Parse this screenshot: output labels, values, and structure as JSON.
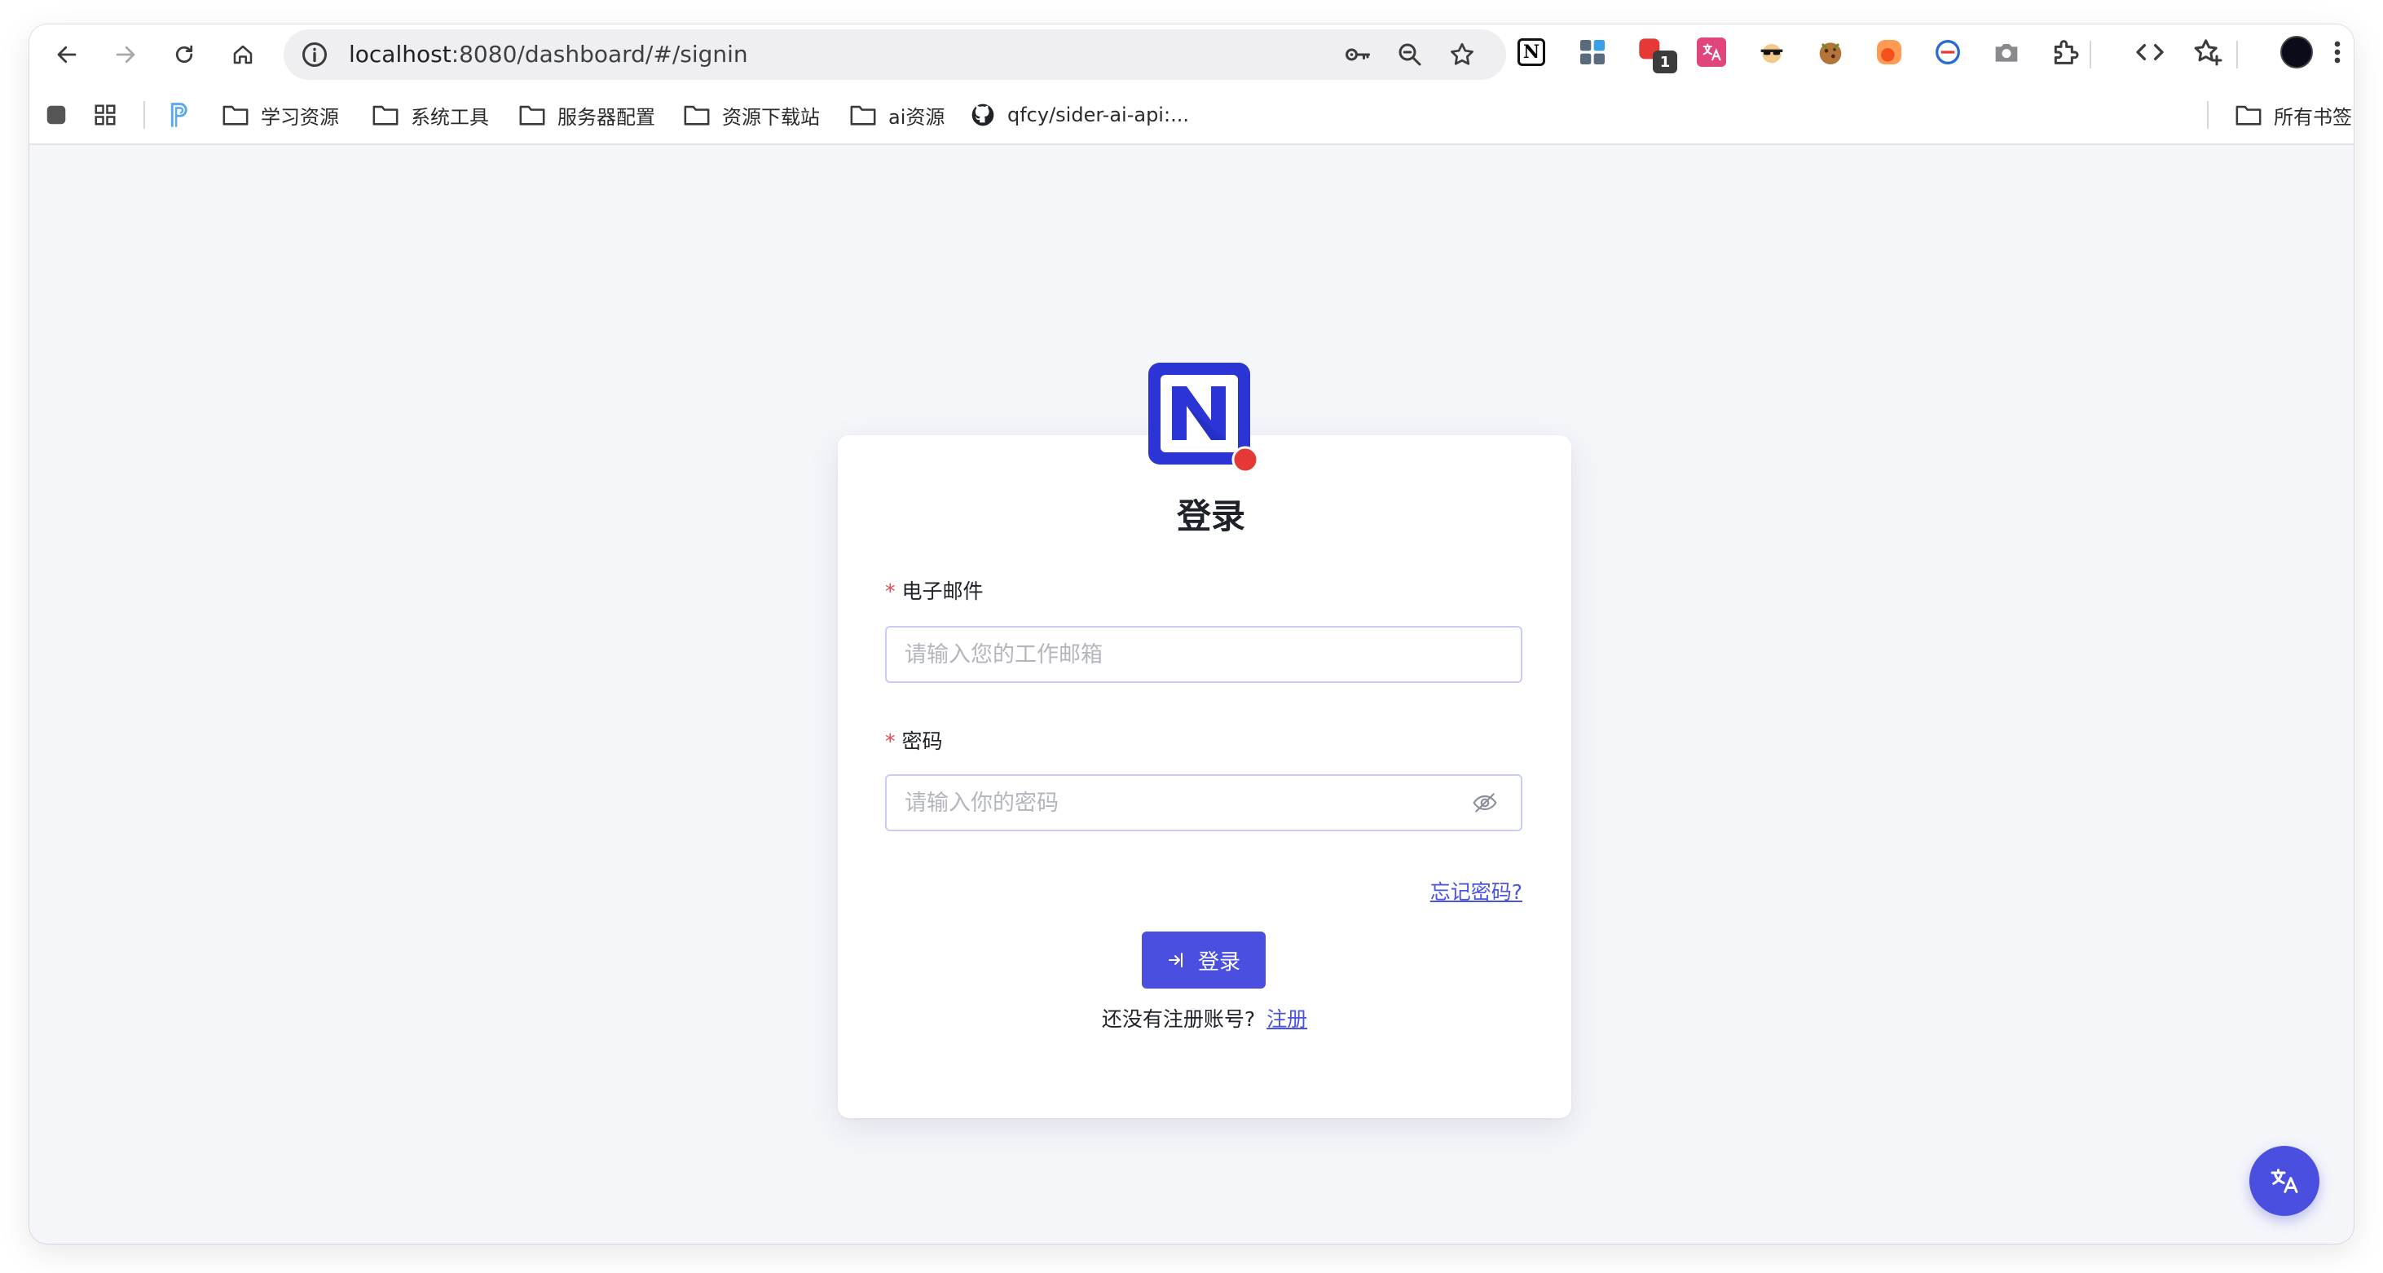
{
  "browser": {
    "url_host": "localhost",
    "url_rest": ":8080/dashboard/#/signin",
    "extension_badge": "1",
    "bookmarks": [
      {
        "label": "学习资源",
        "icon": "folder-icon"
      },
      {
        "label": "系统工具",
        "icon": "folder-icon"
      },
      {
        "label": "服务器配置",
        "icon": "folder-icon"
      },
      {
        "label": "资源下载站",
        "icon": "folder-icon"
      },
      {
        "label": "ai资源",
        "icon": "folder-icon"
      },
      {
        "label": "qfcy/sider-ai-api:...",
        "icon": "github-icon"
      }
    ],
    "all_bookmarks": "所有书签"
  },
  "signin": {
    "title": "登录",
    "email_label": "电子邮件",
    "email_placeholder": "请输入您的工作邮箱",
    "password_label": "密码",
    "password_placeholder": "请输入你的密码",
    "forgot_link": "忘记密码?",
    "login_button": "登录",
    "no_account_text": "还没有注册账号?",
    "register_link": "注册",
    "required_mark": "*"
  },
  "colors": {
    "accent": "#4a4fe0",
    "link": "#4a54e1",
    "required": "#e5484d",
    "logo_blue": "#2b35d6",
    "logo_dot": "#e53935",
    "page_bg": "#f5f6fa"
  }
}
